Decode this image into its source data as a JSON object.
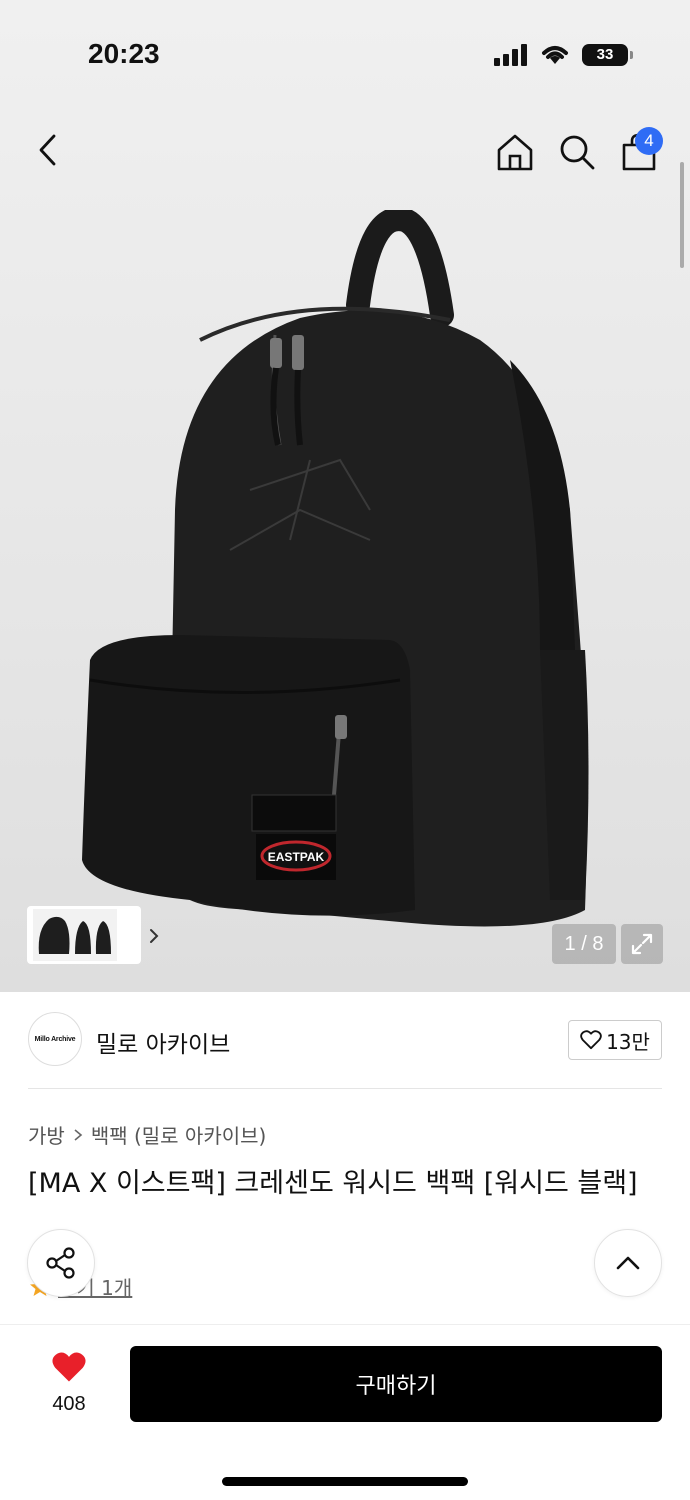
{
  "status": {
    "time": "20:23",
    "battery": "33"
  },
  "header": {
    "cart_count": "4"
  },
  "gallery": {
    "counter": "1 / 8"
  },
  "brand": {
    "logo_text": "Millo Archive",
    "name": "밀로 아카이브",
    "likes": "13만"
  },
  "breadcrumb": {
    "category": "가방",
    "subcategory": "백팩 (밀로 아카이브)"
  },
  "product": {
    "title": "[MA X 이스트팩] 크레센도 워시드 백팩 [워시드 블랙]",
    "review_link": "후기 1개",
    "patch_brand": "EASTPAK"
  },
  "bottom": {
    "wish_count": "408",
    "buy_label": "구매하기"
  },
  "colors": {
    "accent_badge": "#2f6cf5",
    "heart": "#e8202a",
    "star": "#f5a623",
    "buy_button": "#000000"
  },
  "icons": [
    "back-icon",
    "home-icon",
    "search-icon",
    "cart-icon",
    "chevron-right-icon",
    "expand-icon",
    "heart-outline-icon",
    "share-icon",
    "chevron-up-icon",
    "heart-filled-icon",
    "star-icon"
  ]
}
